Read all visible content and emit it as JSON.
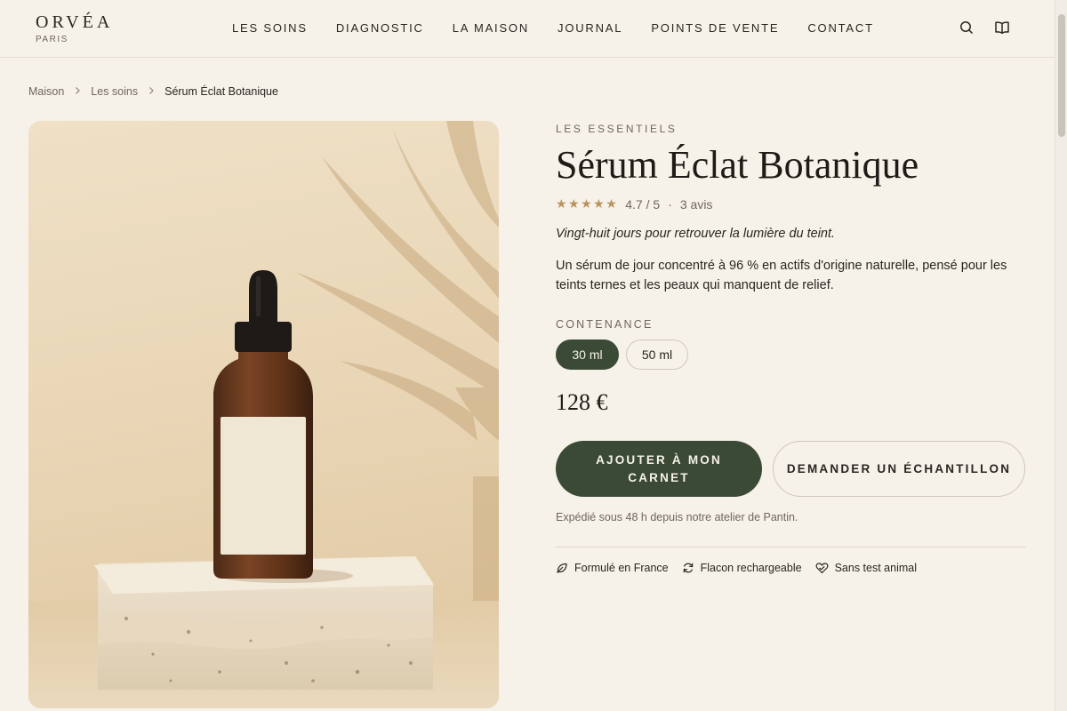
{
  "brand": {
    "name": "ORVÉA",
    "city": "PARIS"
  },
  "nav": [
    "LES SOINS",
    "DIAGNOSTIC",
    "LA MAISON",
    "JOURNAL",
    "POINTS DE VENTE",
    "CONTACT"
  ],
  "breadcrumb": {
    "home": "Maison",
    "category": "Les soins",
    "current": "Sérum Éclat Botanique"
  },
  "product": {
    "collection": "LES ESSENTIELS",
    "title": "Sérum Éclat Botanique",
    "rating": "4.7 / 5",
    "stars": 5,
    "reviews": "3 avis",
    "tagline": "Vingt-huit jours pour retrouver la lumière du teint.",
    "description": "Un sérum de jour concentré à 96 % en actifs d'origine naturelle, pensé pour les teints ternes et les peaux qui manquent de relief.",
    "size_label": "CONTENANCE",
    "sizes": [
      "30 ml",
      "50 ml"
    ],
    "selected_size": "30 ml",
    "price": "128 €",
    "add_label": "AJOUTER À MON CARNET",
    "sample_label": "DEMANDER UN ÉCHANTILLON",
    "shipping": "Expédié sous 48 h depuis notre atelier de Pantin.",
    "features": [
      "Formulé en France",
      "Flacon rechargeable",
      "Sans test animal"
    ]
  },
  "icons": {
    "search": "search-icon",
    "journal": "book-icon",
    "leaf": "leaf-icon",
    "refill": "refresh-icon",
    "cruelty": "heart-icon",
    "star": "star-icon",
    "chevron": "chevron-right-icon"
  },
  "colors": {
    "background": "#f6f1e9",
    "accent": "#3a4a35",
    "star": "#b9925e"
  }
}
